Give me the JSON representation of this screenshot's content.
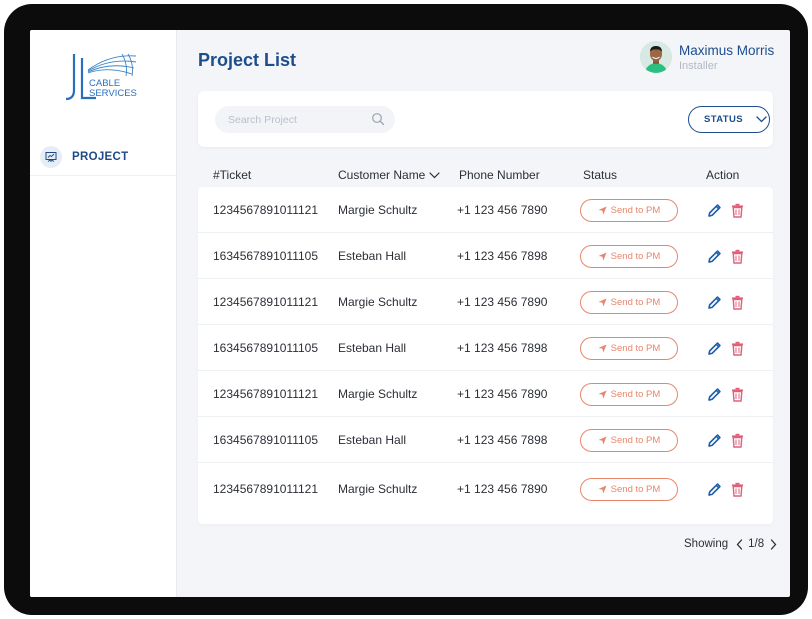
{
  "brand": {
    "logo_letters": "JL",
    "logo_line1": "CABLE",
    "logo_line2": "SERVICES"
  },
  "sidebar": {
    "items": [
      {
        "label": "PROJECT",
        "icon": "presentation-board-icon",
        "active": true
      }
    ]
  },
  "header": {
    "title": "Project List"
  },
  "user": {
    "name": "Maximus Morris",
    "role": "Installer",
    "avatar": "user-avatar"
  },
  "filters": {
    "search_placeholder": "Search Project",
    "search_value": "",
    "status_label": "STATUS"
  },
  "table": {
    "columns": {
      "ticket": "#Ticket",
      "customer": "Customer Name",
      "phone": "Phone Number",
      "status": "Status",
      "action": "Action"
    },
    "rows": [
      {
        "ticket": "1234567891011121",
        "customer": "Margie Schultz",
        "phone": "+1 123 456 7890",
        "status_button": "Send to PM"
      },
      {
        "ticket": "1634567891011105",
        "customer": "Esteban Hall",
        "phone": "+1 123 456 7898",
        "status_button": "Send to PM"
      },
      {
        "ticket": "1234567891011121",
        "customer": "Margie Schultz",
        "phone": "+1 123 456 7890",
        "status_button": "Send to PM"
      },
      {
        "ticket": "1634567891011105",
        "customer": "Esteban Hall",
        "phone": "+1 123 456 7898",
        "status_button": "Send to PM"
      },
      {
        "ticket": "1234567891011121",
        "customer": "Margie Schultz",
        "phone": "+1 123 456 7890",
        "status_button": "Send to PM"
      },
      {
        "ticket": "1634567891011105",
        "customer": "Esteban Hall",
        "phone": "+1 123 456 7898",
        "status_button": "Send to PM"
      },
      {
        "ticket": "1234567891011121",
        "customer": "Margie Schultz",
        "phone": "+1 123 456 7890",
        "status_button": "Send to PM"
      }
    ]
  },
  "pagination": {
    "label": "Showing",
    "page": "1/8"
  },
  "colors": {
    "primary": "#1c4d8c",
    "send_button": "#e8866b",
    "edit_icon": "#1c5fa8",
    "delete_icon": "#e0607a",
    "background": "#f4f5f9"
  }
}
